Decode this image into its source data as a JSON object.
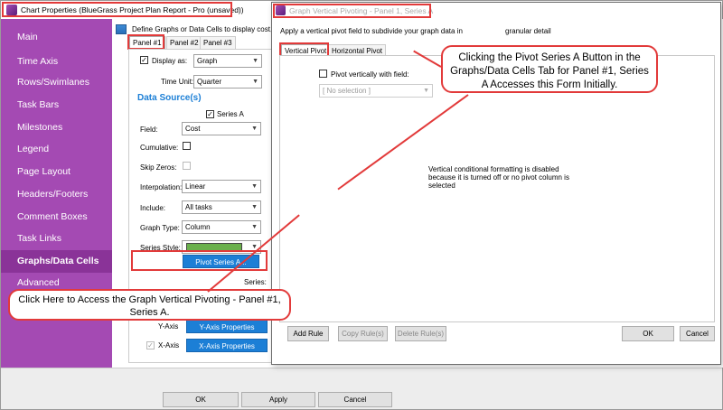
{
  "main_window": {
    "title": "Chart Properties (BlueGrass Project Plan Report - Pro (unsaved))"
  },
  "sidebar": {
    "items": [
      "Main",
      "Time Axis",
      "Rows/Swimlanes",
      "Task Bars",
      "Milestones",
      "Legend",
      "Page Layout",
      "Headers/Footers",
      "Comment Boxes",
      "Task Links",
      "Graphs/Data Cells",
      "Advanced"
    ],
    "selected": "Graphs/Data Cells"
  },
  "content": {
    "description": "Define Graphs or Data Cells to display cost,",
    "panel_tabs": [
      "Panel #1",
      "Panel #2",
      "Panel #3"
    ],
    "display_as": {
      "label": "Display as:",
      "value": "Graph"
    },
    "time_unit": {
      "label": "Time Unit:",
      "value": "Quarter"
    },
    "data_source_heading": "Data Source(s)",
    "series_label": "Series A",
    "field": {
      "label": "Field:",
      "value": "Cost"
    },
    "cumulative": {
      "label": "Cumulative:"
    },
    "skip_zeros": {
      "label": "Skip Zeros:"
    },
    "interpolation": {
      "label": "Interpolation:",
      "value": "Linear"
    },
    "include": {
      "label": "Include:",
      "value": "All tasks"
    },
    "graph_type": {
      "label": "Graph Type:",
      "value": "Column"
    },
    "series_style": {
      "label": "Series Style:",
      "color": "#6ab04c"
    },
    "pivot_button": "Pivot Series A...",
    "series_label2": "Series:",
    "y_axis": {
      "label": "Y-Axis",
      "button": "Y-Axis Properties"
    },
    "x_axis": {
      "label": "X-Axis",
      "button": "X-Axis Properties"
    }
  },
  "bottom_buttons": {
    "ok": "OK",
    "apply": "Apply",
    "cancel": "Cancel"
  },
  "dialog": {
    "title": "Graph Vertical Pivoting - Panel 1, Series A",
    "instruction_start": "Apply a vertical pivot field to subdivide your graph data in",
    "instruction_end": "granular detail",
    "tabs": [
      "Vertical Pivot",
      "Horizontal Pivot"
    ],
    "pivot_checkbox_label": "Pivot vertically with field:",
    "no_selection": "[ No selection ]",
    "disabled_message": "Vertical conditional formatting is disabled because it is turned off or no pivot column is selected",
    "buttons": {
      "add_rule": "Add Rule",
      "copy_rules": "Copy Rule(s)",
      "delete_rules": "Delete Rule(s)",
      "ok": "OK",
      "cancel": "Cancel"
    }
  },
  "callouts": {
    "top": "Clicking the Pivot Series A Button in the Graphs/Data Cells Tab for Panel #1, Series A Accesses this Form Initially.",
    "bottom": "Click Here to Access the Graph Vertical Pivoting - Panel #1, Series A."
  },
  "colors": {
    "sidebar": "#a44ab3",
    "accent_blue": "#1c7fd6",
    "callout_border": "#e23a3a"
  }
}
